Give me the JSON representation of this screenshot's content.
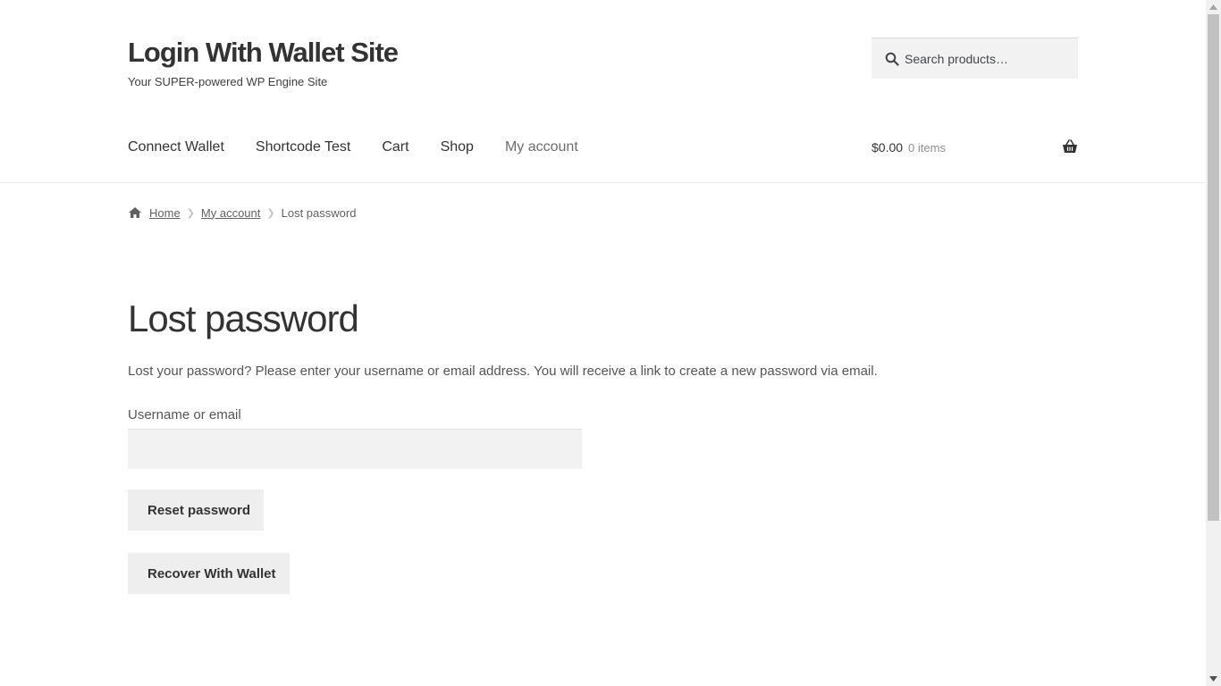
{
  "header": {
    "site_title": "Login With Wallet Site",
    "tagline": "Your SUPER-powered WP Engine Site"
  },
  "search": {
    "placeholder": "Search products…",
    "icon": "search-icon"
  },
  "nav": {
    "items": [
      {
        "label": "Connect Wallet"
      },
      {
        "label": "Shortcode Test"
      },
      {
        "label": "Cart"
      },
      {
        "label": "Shop"
      },
      {
        "label": "My account",
        "current": true
      }
    ]
  },
  "cart": {
    "amount": "$0.00",
    "count": "0 items",
    "icon": "basket-icon"
  },
  "breadcrumb": {
    "home": "Home",
    "parent": "My account",
    "current": "Lost password"
  },
  "content": {
    "title": "Lost password",
    "intro": "Lost your password? Please enter your username or email address. You will receive a link to create a new password via email.",
    "field_label": "Username or email",
    "field_value": "",
    "reset_button": "Reset password",
    "wallet_button": "Recover With Wallet"
  },
  "colors": {
    "text": "#43454b",
    "heading": "#333333",
    "button_bg": "#eeeeee",
    "input_bg": "#f2f2f2"
  }
}
